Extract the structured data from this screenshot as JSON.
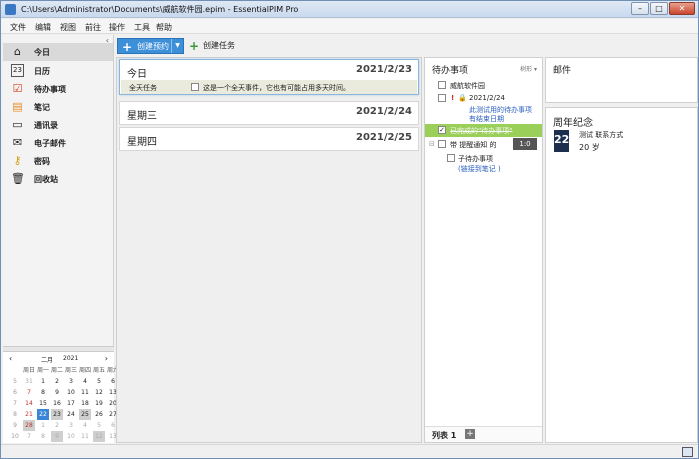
{
  "window": {
    "title": "C:\\Users\\Administrator\\Documents\\威航软件园.epim - EssentialPIM Pro"
  },
  "menu": [
    "文件",
    "编辑",
    "视图",
    "前往",
    "操作",
    "工具",
    "帮助"
  ],
  "sidebar": {
    "items": [
      {
        "label": "今日",
        "icon": "home-icon",
        "selected": true
      },
      {
        "label": "日历",
        "icon": "calendar-icon"
      },
      {
        "label": "待办事项",
        "icon": "checklist-icon"
      },
      {
        "label": "笔记",
        "icon": "note-icon"
      },
      {
        "label": "通讯录",
        "icon": "contact-card-icon"
      },
      {
        "label": "电子邮件",
        "icon": "email-icon"
      },
      {
        "label": "密码",
        "icon": "key-icon"
      },
      {
        "label": "回收站",
        "icon": "trash-icon"
      }
    ]
  },
  "minical": {
    "month": "二月",
    "year": "2021",
    "weekdays": [
      "周日",
      "周一",
      "周二",
      "周三",
      "周四",
      "周五",
      "周六"
    ],
    "weeks": [
      {
        "wk": "5",
        "days": [
          "31",
          "1",
          "2",
          "3",
          "4",
          "5",
          "6"
        ]
      },
      {
        "wk": "6",
        "days": [
          "7",
          "8",
          "9",
          "10",
          "11",
          "12",
          "13"
        ]
      },
      {
        "wk": "7",
        "days": [
          "14",
          "15",
          "16",
          "17",
          "18",
          "19",
          "20"
        ]
      },
      {
        "wk": "8",
        "days": [
          "21",
          "22",
          "23",
          "24",
          "25",
          "26",
          "27"
        ]
      },
      {
        "wk": "9",
        "days": [
          "28",
          "1",
          "2",
          "3",
          "4",
          "5",
          "6"
        ]
      },
      {
        "wk": "10",
        "days": [
          "7",
          "8",
          "9",
          "10",
          "11",
          "12",
          "13"
        ]
      }
    ]
  },
  "toolbar": {
    "new_appt": "创建预约",
    "new_task": "创建任务"
  },
  "days": [
    {
      "name": "今日",
      "date": "2021/2/23"
    },
    {
      "name": "星期三",
      "date": "2021/2/24"
    },
    {
      "name": "星期四",
      "date": "2021/2/25"
    }
  ],
  "allday": {
    "label": "全天任务",
    "text": "这是一个全天事件，它也有可能占用多天时间。"
  },
  "todo": {
    "title": "待办事项",
    "view": "树形",
    "items": [
      {
        "text": "威航软件园"
      },
      {
        "text": "2021/2/24"
      },
      {
        "text": "此测试用的待办事项"
      },
      {
        "text": "有结束日期"
      },
      {
        "text": "已完成的\"待办事项\""
      },
      {
        "text": "带 提醒通知 的"
      },
      {
        "text": "子待办事项"
      },
      {
        "text": "(链接到笔记 )"
      }
    ],
    "badge": "1:0",
    "tab": "列表 1"
  },
  "mail": {
    "title": "邮件"
  },
  "anniversary": {
    "title": "周年纪念",
    "day": "22",
    "name": "测试 联系方式",
    "age": "20 岁"
  }
}
